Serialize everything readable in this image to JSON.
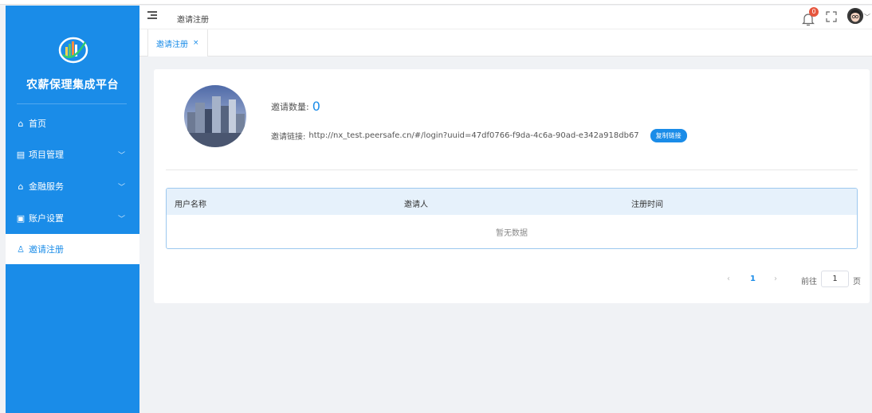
{
  "sidebar": {
    "brand": "农薪保理集成平台",
    "items": [
      {
        "label": "首页",
        "icon": "home-icon"
      },
      {
        "label": "项目管理",
        "icon": "project-icon"
      },
      {
        "label": "金融服务",
        "icon": "bank-icon"
      },
      {
        "label": "账户设置",
        "icon": "account-card-icon"
      },
      {
        "label": "邀请注册",
        "icon": "user-icon"
      }
    ]
  },
  "header": {
    "breadcrumb": "邀请注册",
    "notification_count": "0"
  },
  "tabs": [
    {
      "label": "邀请注册",
      "close": "×"
    }
  ],
  "invite": {
    "count_label": "邀请数量:",
    "count_value": "0",
    "link_label": "邀请链接:",
    "link_value": "http://nx_test.peersafe.cn/#/login?uuid=47df0766-f9da-4c6a-90ad-e342a918db67",
    "copy_button": "复制链接"
  },
  "table": {
    "columns": [
      "用户名称",
      "邀请人",
      "注册时间"
    ],
    "empty_text": "暂无数据"
  },
  "pagination": {
    "prev": "‹",
    "current_page": "1",
    "next": "›",
    "goto_label": "前往",
    "goto_value": "1",
    "page_suffix": "页"
  },
  "colors": {
    "accent": "#1a8ce8",
    "badge": "#e6553d",
    "table_header": "#e6f1fb"
  }
}
